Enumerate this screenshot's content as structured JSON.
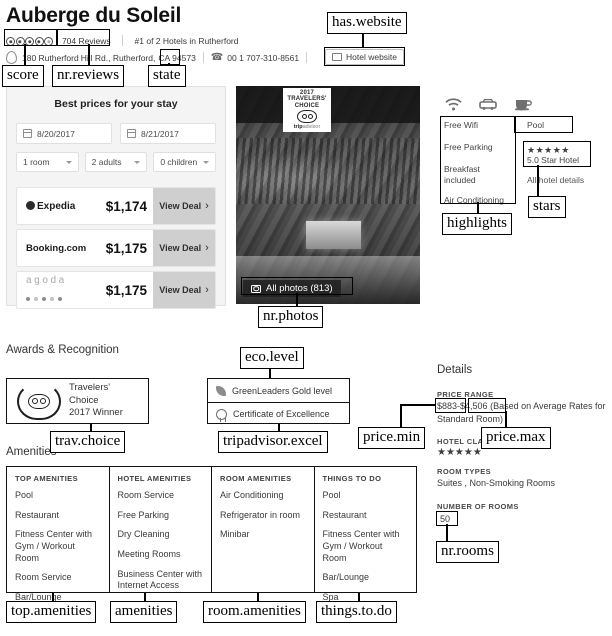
{
  "header": {
    "hotel_name": "Auberge du Soleil",
    "review_count": "704 Reviews",
    "rank": "#1 of 2 Hotels in Rutherford",
    "address_street": "180 Rutherford",
    "address_rest": "Hill Rd., Rutherford,",
    "state": "CA",
    "zip": "94573",
    "phone": "00 1 707-310-8561",
    "website_label": "Hotel website",
    "score_bubbles": 5
  },
  "booking": {
    "title": "Best prices for your stay",
    "check_in": "8/20/2017",
    "check_out": "8/21/2017",
    "rooms": "1 room",
    "adults": "2 adults",
    "children": "0 children",
    "deals": [
      {
        "brand": "Expedia",
        "price": "$1,174",
        "cta": "View Deal"
      },
      {
        "brand": "Booking.com",
        "price": "$1,175",
        "cta": "View Deal"
      },
      {
        "brand": "agoda",
        "price": "$1,175",
        "cta": "View Deal"
      }
    ]
  },
  "photo": {
    "all_photos": "All photos (813)",
    "award_year": "2017",
    "award_line1": "TRAVELERS'",
    "award_line2": "CHOICE",
    "award_brand": "trip",
    "award_brand_suffix": "advisor"
  },
  "highlights": {
    "items": [
      "Free Wifi",
      "Free Parking",
      "Breakfast included",
      "Air Conditioning"
    ],
    "pool": "Pool",
    "star_glyphs": "★★★★★",
    "star_text": "5.0 Star Hotel",
    "all_details": "All hotel details",
    "icons": [
      "wifi-icon",
      "parking-car-icon",
      "breakfast-cup-icon"
    ]
  },
  "awards": {
    "section_title": "Awards & Recognition",
    "travelers_choice_line1": "Travelers' Choice",
    "travelers_choice_line2": "2017 Winner",
    "greenleaders": "GreenLeaders Gold level",
    "certificate": "Certificate of Excellence"
  },
  "details": {
    "section_title": "Details",
    "price_range_label": "PRICE RANGE",
    "price_min": "$883",
    "price_dash": "-",
    "price_max": "$4,506",
    "price_note": "(Based on Average Rates for Standard Room)",
    "hotel_class_label": "HOTEL CLASS",
    "hotel_class_stars": "★★★★★",
    "room_types_label": "ROOM TYPES",
    "room_types": "Suites , Non-Smoking Rooms",
    "number_of_rooms_label": "NUMBER OF ROOMS",
    "number_of_rooms": "50"
  },
  "amenities": {
    "section_title": "Amenities",
    "columns": [
      {
        "header": "TOP AMENITIES",
        "items": [
          "Pool",
          "Restaurant",
          "Fitness Center with Gym / Workout Room",
          "Room Service",
          "Bar/Lounge"
        ]
      },
      {
        "header": "HOTEL AMENITIES",
        "items": [
          "Room Service",
          "Free Parking",
          "Dry Cleaning",
          "Meeting Rooms",
          "Business Center with Internet Access"
        ]
      },
      {
        "header": "ROOM AMENITIES",
        "items": [
          "Air Conditioning",
          "Refrigerator in room",
          "Minibar"
        ]
      },
      {
        "header": "THINGS TO DO",
        "items": [
          "Pool",
          "Restaurant",
          "Fitness Center with Gym / Workout Room",
          "Bar/Lounge",
          "Spa"
        ]
      }
    ]
  },
  "annotations": {
    "has_website": "has.website",
    "score": "score",
    "nr_reviews": "nr.reviews",
    "state": "state",
    "nr_photos": "nr.photos",
    "highlights": "highlights",
    "stars": "stars",
    "eco_level": "eco.level",
    "trav_choice": "trav.choice",
    "tripadvisor_excel": "tripadvisor.excel",
    "price_min": "price.min",
    "price_max": "price.max",
    "nr_rooms": "nr.rooms",
    "top_amenities": "top.amenities",
    "amenities": "amenities",
    "room_amenities": "room.amenities",
    "things_to_do": "things.to.do"
  }
}
